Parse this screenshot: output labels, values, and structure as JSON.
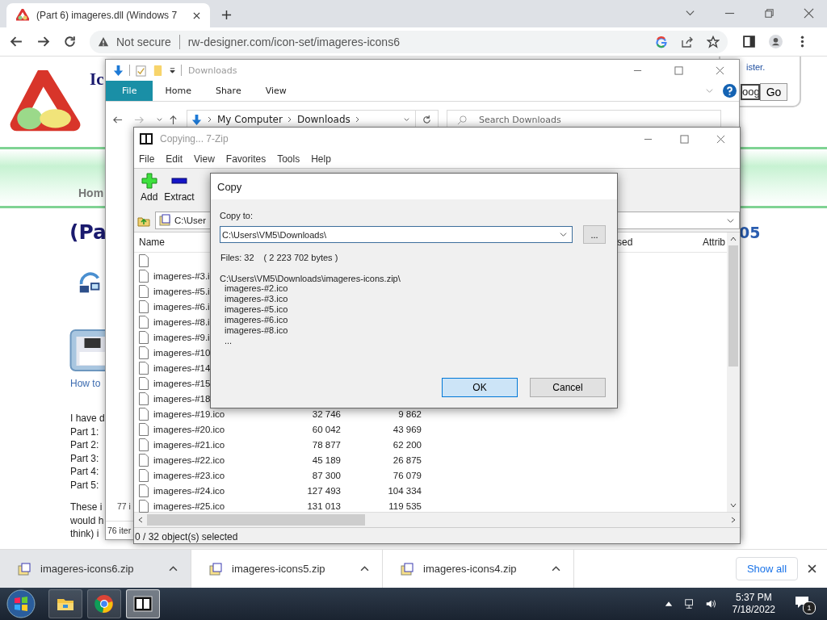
{
  "browser": {
    "tab": {
      "title": "(Part 6) imageres.dll (Windows 7",
      "selected": true
    },
    "security": "Not secure",
    "url": "rw-designer.com/icon-set/imageres-icons6"
  },
  "website": {
    "heading": "Ic",
    "account_link": "ister.",
    "search_value": "oog",
    "go_button": "Go",
    "nav_item": "Hom",
    "title": "(Pa",
    "title_end": "05",
    "link": "How to",
    "intro_lines": [
      "I have d",
      "Part 1:",
      "Part 2:",
      "Part 3:",
      "Part 4:",
      "Part 5:"
    ],
    "paragraph_lines": [
      "These i",
      "would h",
      "think) i"
    ]
  },
  "explorer": {
    "title": "Downloads",
    "ribbon_tabs": [
      {
        "label": "File",
        "selected": true
      },
      {
        "label": "Home",
        "selected": false
      },
      {
        "label": "Share",
        "selected": false
      },
      {
        "label": "View",
        "selected": false
      }
    ],
    "breadcrumb": [
      "My Computer",
      "Downloads"
    ],
    "search_placeholder": "Search Downloads",
    "item_count": "77 i",
    "status": "76 iter"
  },
  "sevenzip": {
    "title": "Copying... 7-Zip",
    "menu": [
      "File",
      "Edit",
      "View",
      "Favorites",
      "Tools",
      "Help"
    ],
    "toolbar": [
      {
        "label": "Add",
        "kind": "add"
      },
      {
        "label": "Extract",
        "kind": "extract"
      }
    ],
    "path": "C:\\User",
    "columns": [
      "Name",
      "sed",
      "Attrib"
    ],
    "rows": [
      {},
      {
        "name": "imageres-#3.i"
      },
      {
        "name": "imageres-#5.i"
      },
      {
        "name": "imageres-#6.i"
      },
      {
        "name": "imageres-#8.i"
      },
      {
        "name": "imageres-#9.i"
      },
      {
        "name": "imageres-#10"
      },
      {
        "name": "imageres-#14"
      },
      {
        "name": "imageres-#15"
      },
      {
        "name": "imageres-#18"
      },
      {
        "name": "imageres-#19.ico",
        "size": "32 746",
        "packed": "9 862"
      },
      {
        "name": "imageres-#20.ico",
        "size": "60 042",
        "packed": "43 969"
      },
      {
        "name": "imageres-#21.ico",
        "size": "78 877",
        "packed": "62 200"
      },
      {
        "name": "imageres-#22.ico",
        "size": "45 189",
        "packed": "26 875"
      },
      {
        "name": "imageres-#23.ico",
        "size": "87 300",
        "packed": "76 079"
      },
      {
        "name": "imageres-#24.ico",
        "size": "127 493",
        "packed": "104 334"
      },
      {
        "name": "imageres-#25.ico",
        "size": "131 013",
        "packed": "119 535"
      }
    ],
    "status": "0 / 32 object(s) selected"
  },
  "dialog": {
    "title": "Copy",
    "label": "Copy to:",
    "path": "C:\\Users\\VM5\\Downloads\\",
    "browse": "...",
    "files_count": "Files: 32",
    "bytes": "( 2 223 702 bytes )",
    "archive": "C:\\Users\\VM5\\Downloads\\imageres-icons.zip\\",
    "files": [
      "imageres-#2.ico",
      "imageres-#3.ico",
      "imageres-#5.ico",
      "imageres-#6.ico",
      "imageres-#8.ico",
      "..."
    ],
    "buttons": [
      {
        "label": "OK",
        "kind": "default"
      },
      {
        "label": "Cancel",
        "kind": "normal"
      }
    ]
  },
  "downloads": {
    "items": [
      {
        "name": "imageres-icons6.zip",
        "selected": true
      },
      {
        "name": "imageres-icons5.zip",
        "selected": false
      },
      {
        "name": "imageres-icons4.zip",
        "selected": false
      }
    ],
    "show_all": "Show all"
  },
  "taskbar": {
    "apps": [
      {
        "kind": "folder",
        "selected": false
      },
      {
        "kind": "browser",
        "selected": false
      },
      {
        "kind": "archiver",
        "selected": true
      }
    ],
    "time": "5:37 PM",
    "date": "7/18/2022",
    "notifications": "1"
  }
}
